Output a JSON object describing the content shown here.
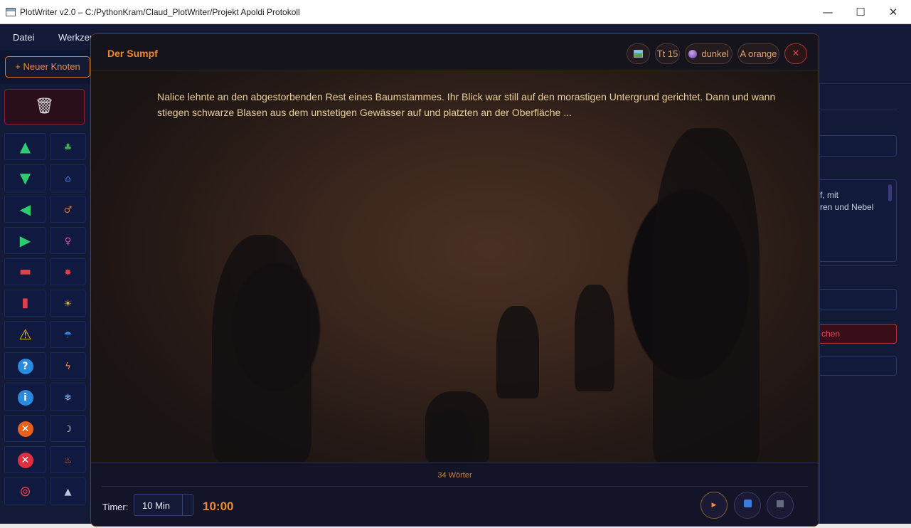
{
  "window": {
    "title": "PlotWriter v2.0 – C:/PythonKram/Claud_PlotWriter/Projekt Apoldi Protokoll",
    "minimize": "—",
    "maximize": "☐",
    "close": "✕"
  },
  "menu": {
    "items": [
      "Datei",
      "Werkzeu"
    ]
  },
  "toolbar": {
    "new_node_label": "+ Neuer Knoten"
  },
  "left_panel": {
    "trash_icon": "trash-icon",
    "tiles": [
      {
        "left": "triangle-up-icon",
        "left_glyph": "▲",
        "left_color": "#2ecc71",
        "right": "tree-icon",
        "right_glyph": "♣",
        "right_color": "#3fb048"
      },
      {
        "left": "triangle-down-icon",
        "left_glyph": "▼",
        "left_color": "#2ecc71",
        "right": "house-icon",
        "right_glyph": "⌂",
        "right_color": "#4a7be0"
      },
      {
        "left": "triangle-left-icon",
        "left_glyph": "◀",
        "left_color": "#2ecc71",
        "right": "male-icon",
        "right_glyph": "♂",
        "right_color": "#e07b28"
      },
      {
        "left": "triangle-right-icon",
        "left_glyph": "▶",
        "left_color": "#2ecc71",
        "right": "female-icon",
        "right_glyph": "♀",
        "right_color": "#d65aa8"
      },
      {
        "left": "minus-icon",
        "left_glyph": "▬",
        "left_color": "#e0404a",
        "right": "burst-icon",
        "right_glyph": "✸",
        "right_color": "#e04040"
      },
      {
        "left": "vertical-bar-icon",
        "left_glyph": "▮",
        "left_color": "#e0404a",
        "right": "sun-icon",
        "right_glyph": "☀",
        "right_color": "#f0c030"
      },
      {
        "left": "warning-icon",
        "left_glyph": "⚠",
        "left_color": "#f0c020",
        "right": "umbrella-icon",
        "right_glyph": "☂",
        "right_color": "#3a8ae0"
      },
      {
        "left": "question-icon",
        "left_glyph": "?",
        "left_color": "#ffffff",
        "right": "lightning-icon",
        "right_glyph": "ϟ",
        "right_color": "#f08a30"
      },
      {
        "left": "info-icon",
        "left_glyph": "i",
        "left_color": "#ffffff",
        "right": "snowflake-icon",
        "right_glyph": "❄",
        "right_color": "#7ab8f0"
      },
      {
        "left": "orange-x-icon",
        "left_glyph": "✕",
        "left_color": "#ffffff",
        "right": "moon-icon",
        "right_glyph": "☽",
        "right_color": "#e8e0c0"
      },
      {
        "left": "red-x-icon",
        "left_glyph": "✕",
        "left_color": "#ffffff",
        "right": "fire-icon",
        "right_glyph": "♨",
        "right_color": "#f06a20"
      },
      {
        "left": "lifebuoy-icon",
        "left_glyph": "⊚",
        "left_color": "#e04040",
        "right": "gray-triangle-icon",
        "right_glyph": "▲",
        "right_color": "#c0c4d0"
      }
    ]
  },
  "right_panel": {
    "desc_line1": "f, mit",
    "desc_line2": "ren und Nebel",
    "button_label": "chen"
  },
  "dialog": {
    "title": "Der Sumpf",
    "font_size_label": "Tt 15",
    "theme_label": "dunkel",
    "color_label": "A orange",
    "close_glyph": "✕",
    "text": "Nalice lehnte an den abgestorbenden Rest eines Baumstammes. Ihr Blick war still auf den morastigen Untergrund gerichtet. Dann und wann stiegen schwarze Blasen aus dem unstetigen Gewässer auf und platzten an der Oberfläche ...",
    "word_count": "34 Wörter",
    "timer_label": "Timer:",
    "timer_value": "10 Min",
    "timer_display": "10:00",
    "play_glyph": "▶"
  }
}
